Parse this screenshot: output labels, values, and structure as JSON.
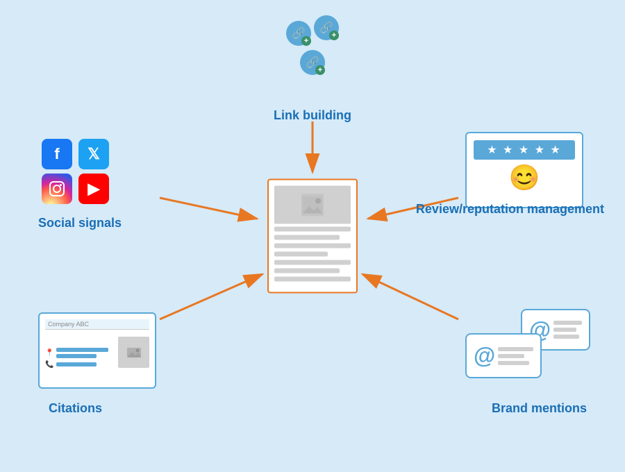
{
  "background_color": "#d6eaf8",
  "accent_color": "#e87722",
  "primary_color": "#1a6fb5",
  "secondary_color": "#5aa8d8",
  "labels": {
    "link_building": "Link building",
    "social_signals": "Social signals",
    "review_reputation": "Review/reputation\nmanagement",
    "citations": "Citations",
    "brand_mentions": "Brand mentions"
  },
  "citation_company": "Company ABC",
  "social_icons": [
    "Facebook",
    "Twitter",
    "Instagram",
    "YouTube"
  ],
  "review_stars": "★ ★ ★ ★ ★",
  "center_document": "webpage"
}
